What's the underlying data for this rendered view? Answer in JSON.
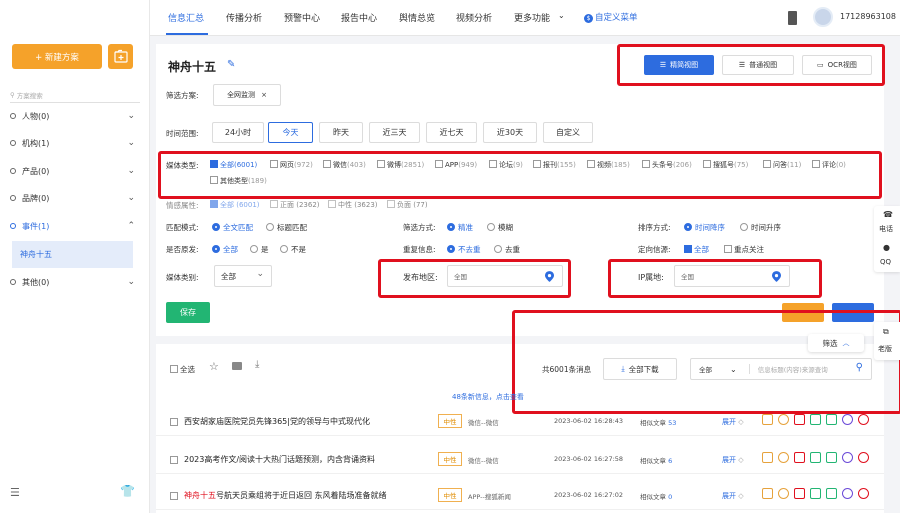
{
  "sidebar": {
    "new_button": "+ 新建方案",
    "search_placeholder": "方案搜索",
    "categories": [
      {
        "label": "人物(0)"
      },
      {
        "label": "机构(1)"
      },
      {
        "label": "产品(0)"
      },
      {
        "label": "品牌(0)"
      },
      {
        "label": "事件(1)"
      },
      {
        "label": "其他(0)"
      }
    ],
    "sub_item": "神舟十五"
  },
  "topbar": {
    "nav": [
      "信息汇总",
      "传播分析",
      "预警中心",
      "报告中心",
      "舆情总览",
      "视频分析",
      "更多功能"
    ],
    "custom_menu": "自定义菜单",
    "phone": "17128963108"
  },
  "main": {
    "title": "神舟十五",
    "views": [
      "精简视图",
      "普通视图",
      "OCR视图"
    ],
    "filter_label": "筛选方案:",
    "filter_value": "全网监测",
    "time_label": "时间范围:",
    "time_options": [
      "24小时",
      "今天",
      "昨天",
      "近三天",
      "近七天",
      "近30天",
      "自定义"
    ],
    "media_label": "媒体类型:",
    "media_items": [
      {
        "name": "全部",
        "count": "(6001)"
      },
      {
        "name": "网页",
        "count": "(972)"
      },
      {
        "name": "微信",
        "count": "(403)"
      },
      {
        "name": "微博",
        "count": "(2851)"
      },
      {
        "name": "APP",
        "count": "(949)"
      },
      {
        "name": "论坛",
        "count": "(9)"
      },
      {
        "name": "报刊",
        "count": "(155)"
      },
      {
        "name": "视频",
        "count": "(185)"
      },
      {
        "name": "头条号",
        "count": "(206)"
      },
      {
        "name": "搜狐号",
        "count": "(75)"
      },
      {
        "name": "问答",
        "count": "(11)"
      },
      {
        "name": "评论",
        "count": "(0)"
      }
    ],
    "media_other": {
      "name": "其他类型",
      "count": "(189)"
    },
    "sentiment_label": "情感属性:",
    "sentiment_items": [
      "全部 (6001)",
      "正面 (2362)",
      "中性 (3623)",
      "负面 (77)"
    ],
    "match_label": "匹配模式:",
    "match_options": [
      "全文匹配",
      "标题匹配"
    ],
    "filter_mode_label": "筛选方式:",
    "filter_mode_options": [
      "精准",
      "模糊"
    ],
    "sort_label": "排序方式:",
    "sort_options": [
      "时间降序",
      "时间升序"
    ],
    "original_label": "是否原发:",
    "original_options": [
      "全部",
      "是",
      "不是"
    ],
    "dup_label": "重复信息:",
    "dup_options": [
      "不去重",
      "去重"
    ],
    "source_label": "定向信源:",
    "source_options": [
      "全部",
      "重点关注"
    ],
    "mediacat_label": "媒体类别:",
    "mediacat_value": "全部",
    "region_label": "发布地区:",
    "region_value": "全国",
    "ip_label": "IP属地:",
    "ip_value": "全国",
    "save": "保存",
    "filter_toggle": "筛选"
  },
  "list": {
    "select_all": "全选",
    "count_text": "共6001条消息",
    "download": "全部下载",
    "scope": "全部",
    "search_placeholder": "信息标题(内容)来源查询",
    "new_notice": "48条新信息，点击查看",
    "rows": [
      {
        "title": "西安胡家庙医院党员先锋365|党的领导与中式现代化",
        "hl": "",
        "tag": "中性",
        "source": "微信--微信",
        "time": "2023-06-02 16:28:43",
        "sim_label": "相似文章",
        "sim": "53",
        "expand": "展开"
      },
      {
        "title": "2023高考作文/阅读十大热门话题预测，内含背诵资料",
        "hl": "",
        "tag": "中性",
        "source": "微信--微信",
        "time": "2023-06-02 16:27:58",
        "sim_label": "相似文章",
        "sim": "6",
        "expand": "展开"
      },
      {
        "title": "号航天员乘组将于近日返回 东风着陆场准备就绪",
        "hl": "神舟十五",
        "tag": "中性",
        "source": "APP--搜狐新闻",
        "time": "2023-06-02 16:27:02",
        "sim_label": "相似文章",
        "sim": "0",
        "expand": "展开"
      }
    ]
  },
  "side_tools": {
    "phone": "电话",
    "qq": "QQ",
    "old": "老版"
  },
  "colors": {
    "accent": "#2d6cdf",
    "orange": "#f5a22a",
    "red_box": "#e0101e"
  }
}
